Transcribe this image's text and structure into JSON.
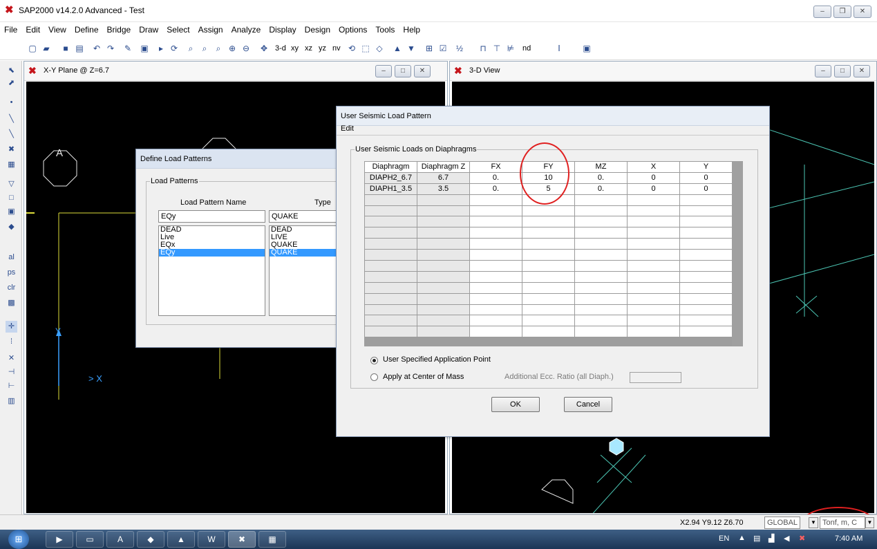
{
  "app": {
    "title": "SAP2000 v14.2.0 Advanced  - Test"
  },
  "menu": [
    "File",
    "Edit",
    "View",
    "Define",
    "Bridge",
    "Draw",
    "Select",
    "Assign",
    "Analyze",
    "Display",
    "Design",
    "Options",
    "Tools",
    "Help"
  ],
  "toolbar": {
    "buttons": [
      "3-d",
      "xy",
      "xz",
      "yz",
      "nv",
      "nd"
    ]
  },
  "window_xy": {
    "title": "X-Y Plane @ Z=6.7",
    "grid_label_a": "A",
    "axis_y": "Y",
    "axis_x": "> X"
  },
  "window_3d": {
    "title": "3-D View"
  },
  "define_load_patterns": {
    "title": "Define Load Patterns",
    "group_label": "Load Patterns",
    "col_name": "Load Pattern Name",
    "col_type": "Type",
    "name_value": "EQy",
    "type_value": "QUAKE",
    "names": [
      "DEAD",
      "Live",
      "EQx",
      "EQy"
    ],
    "types": [
      "DEAD",
      "LIVE",
      "QUAKE",
      "QUAKE"
    ]
  },
  "seismic_dialog": {
    "title": "User Seismic Load Pattern",
    "menu_edit": "Edit",
    "group_label": "User Seismic Loads on Diaphragms",
    "columns": [
      "Diaphragm",
      "Diaphragm Z",
      "FX",
      "FY",
      "MZ",
      "X",
      "Y"
    ],
    "rows": [
      [
        "DIAPH2_6.7",
        "6.7",
        "0.",
        "10",
        "0.",
        "0",
        "0"
      ],
      [
        "DIAPH1_3.5",
        "3.5",
        "0.",
        "5",
        "0.",
        "0",
        "0"
      ]
    ],
    "radio_user": "User Specified Application Point",
    "radio_center": "Apply at Center of Mass",
    "ecc_label": "Additional Ecc. Ratio (all Diaph.)",
    "ok": "OK",
    "cancel": "Cancel"
  },
  "status": {
    "coords": "X2.94  Y9.12  Z6.70",
    "coord_system": "GLOBAL",
    "units": "Tonf, m, C"
  },
  "tray": {
    "lang": "EN",
    "time": "7:40 AM"
  },
  "colors": {
    "canvas": "#000000",
    "grid_line": "#dede3a",
    "axis": "#3aa0ff",
    "frame": "#4cc6b4",
    "highlight": "#e02020"
  }
}
